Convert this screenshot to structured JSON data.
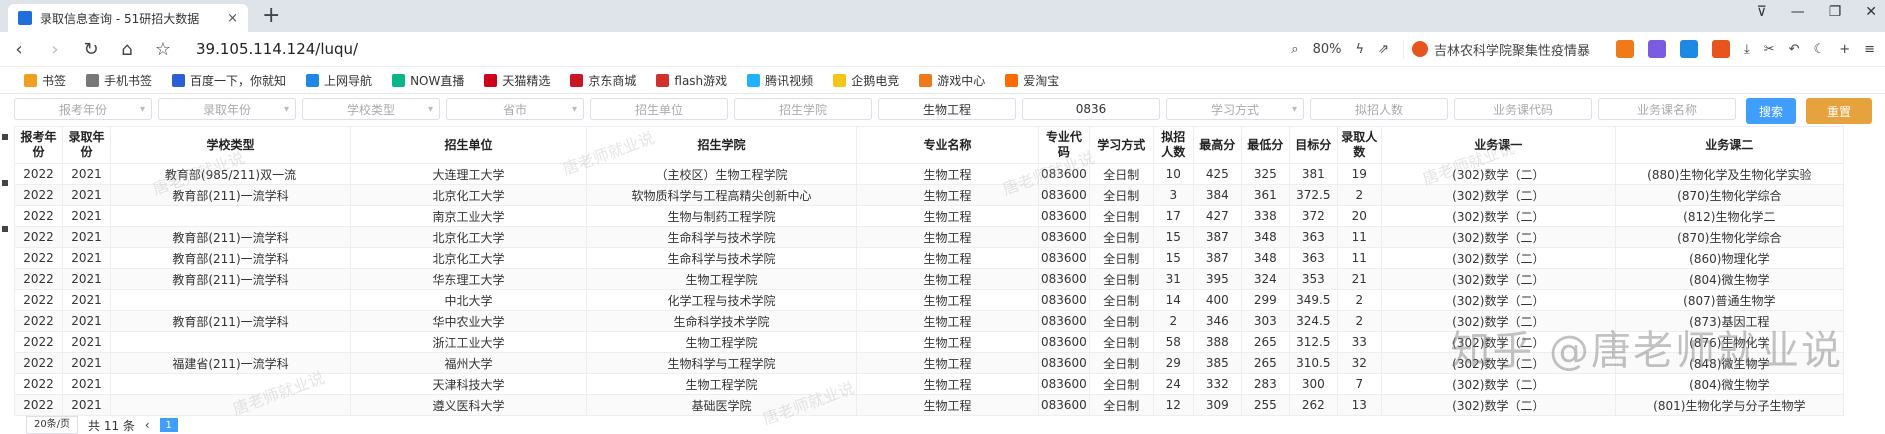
{
  "tab": {
    "title": "录取信息查询 - 51研招大数据",
    "close": "×",
    "new": "+"
  },
  "window_controls": [
    "⊽",
    "—",
    "❐",
    "✕"
  ],
  "nav": {
    "url": "39.105.114.124/luqu/",
    "zoom": "80%",
    "search_text": "吉林农科学院聚集性疫情暴"
  },
  "bookmarks": [
    {
      "label": "书签",
      "color": "#f0a020"
    },
    {
      "label": "手机书签",
      "color": "#777777"
    },
    {
      "label": "百度一下，你就知",
      "color": "#2a5fd6"
    },
    {
      "label": "上网导航",
      "color": "#1e88e5"
    },
    {
      "label": "NOW直播",
      "color": "#0ab58a"
    },
    {
      "label": "天猫精选",
      "color": "#d0021b"
    },
    {
      "label": "京东商城",
      "color": "#c91623"
    },
    {
      "label": "flash游戏",
      "color": "#d0312d"
    },
    {
      "label": "腾讯视频",
      "color": "#20b2ff"
    },
    {
      "label": "企鹅电竞",
      "color": "#f5c518"
    },
    {
      "label": "游戏中心",
      "color": "#f07a1a"
    },
    {
      "label": "爱淘宝",
      "color": "#ff6a00"
    }
  ],
  "filters": {
    "report_year": "报考年份",
    "admit_year": "录取年份",
    "school_type": "学校类型",
    "province": "省市",
    "unit": "招生单位",
    "college": "招生学院",
    "major": "生物工程",
    "code": "0836",
    "mode": "学习方式",
    "planned": "拟招人数",
    "course_code": "业务课代码",
    "course_name": "业务课名称",
    "search": "搜索",
    "reset": "重置"
  },
  "table": {
    "headers": [
      "报考年份",
      "录取年份",
      "学校类型",
      "招生单位",
      "招生学院",
      "专业名称",
      "专业代码",
      "学习方式",
      "拟招人数",
      "最高分",
      "最低分",
      "目标分",
      "录取人数",
      "业务课一",
      "业务课二"
    ],
    "rows": [
      [
        "2022",
        "2021",
        "教育部(985/211)双一流",
        "大连理工大学",
        "（主校区）生物工程学院",
        "生物工程",
        "083600",
        "全日制",
        "10",
        "425",
        "325",
        "381",
        "19",
        "(302)数学（二）",
        "(880)生物化学及生物化学实验"
      ],
      [
        "2022",
        "2021",
        "教育部(211)一流学科",
        "北京化工大学",
        "软物质科学与工程高精尖创新中心",
        "生物工程",
        "083600",
        "全日制",
        "3",
        "384",
        "361",
        "372.5",
        "2",
        "(302)数学（二）",
        "(870)生物化学综合"
      ],
      [
        "2022",
        "2021",
        "",
        "南京工业大学",
        "生物与制药工程学院",
        "生物工程",
        "083600",
        "全日制",
        "17",
        "427",
        "338",
        "372",
        "20",
        "(302)数学（二）",
        "(812)生物化学二"
      ],
      [
        "2022",
        "2021",
        "教育部(211)一流学科",
        "北京化工大学",
        "生命科学与技术学院",
        "生物工程",
        "083600",
        "全日制",
        "15",
        "387",
        "348",
        "363",
        "11",
        "(302)数学（二）",
        "(870)生物化学综合"
      ],
      [
        "2022",
        "2021",
        "教育部(211)一流学科",
        "北京化工大学",
        "生命科学与技术学院",
        "生物工程",
        "083600",
        "全日制",
        "15",
        "387",
        "348",
        "363",
        "11",
        "(302)数学（二）",
        "(860)物理化学"
      ],
      [
        "2022",
        "2021",
        "教育部(211)一流学科",
        "华东理工大学",
        "生物工程学院",
        "生物工程",
        "083600",
        "全日制",
        "31",
        "395",
        "324",
        "353",
        "21",
        "(302)数学（二）",
        "(804)微生物学"
      ],
      [
        "2022",
        "2021",
        "",
        "中北大学",
        "化学工程与技术学院",
        "生物工程",
        "083600",
        "全日制",
        "14",
        "400",
        "299",
        "349.5",
        "2",
        "(302)数学（二）",
        "(807)普通生物学"
      ],
      [
        "2022",
        "2021",
        "教育部(211)一流学科",
        "华中农业大学",
        "生命科学技术学院",
        "生物工程",
        "083600",
        "全日制",
        "2",
        "346",
        "303",
        "324.5",
        "2",
        "(302)数学（二）",
        "(873)基因工程"
      ],
      [
        "2022",
        "2021",
        "",
        "浙江工业大学",
        "生物工程学院",
        "生物工程",
        "083600",
        "全日制",
        "58",
        "388",
        "265",
        "312.5",
        "33",
        "(302)数学（二）",
        "(876)生物化学"
      ],
      [
        "2022",
        "2021",
        "福建省(211)一流学科",
        "福州大学",
        "生物科学与工程学院",
        "生物工程",
        "083600",
        "全日制",
        "29",
        "385",
        "265",
        "310.5",
        "32",
        "(302)数学（二）",
        "(848)微生物学"
      ],
      [
        "2022",
        "2021",
        "",
        "天津科技大学",
        "生物工程学院",
        "生物工程",
        "083600",
        "全日制",
        "24",
        "332",
        "283",
        "300",
        "7",
        "(302)数学（二）",
        "(804)微生物学"
      ],
      [
        "2022",
        "2021",
        "",
        "遵义医科大学",
        "基础医学院",
        "生物工程",
        "083600",
        "全日制",
        "12",
        "309",
        "255",
        "262",
        "13",
        "(302)数学（二）",
        "(801)生物化学与分子生物学"
      ]
    ]
  },
  "pager": {
    "size": "20条/页",
    "total": "共 11 条",
    "page": "1"
  },
  "watermark": {
    "main": "知乎 @唐老师就业说",
    "small": "唐老师就业说"
  }
}
